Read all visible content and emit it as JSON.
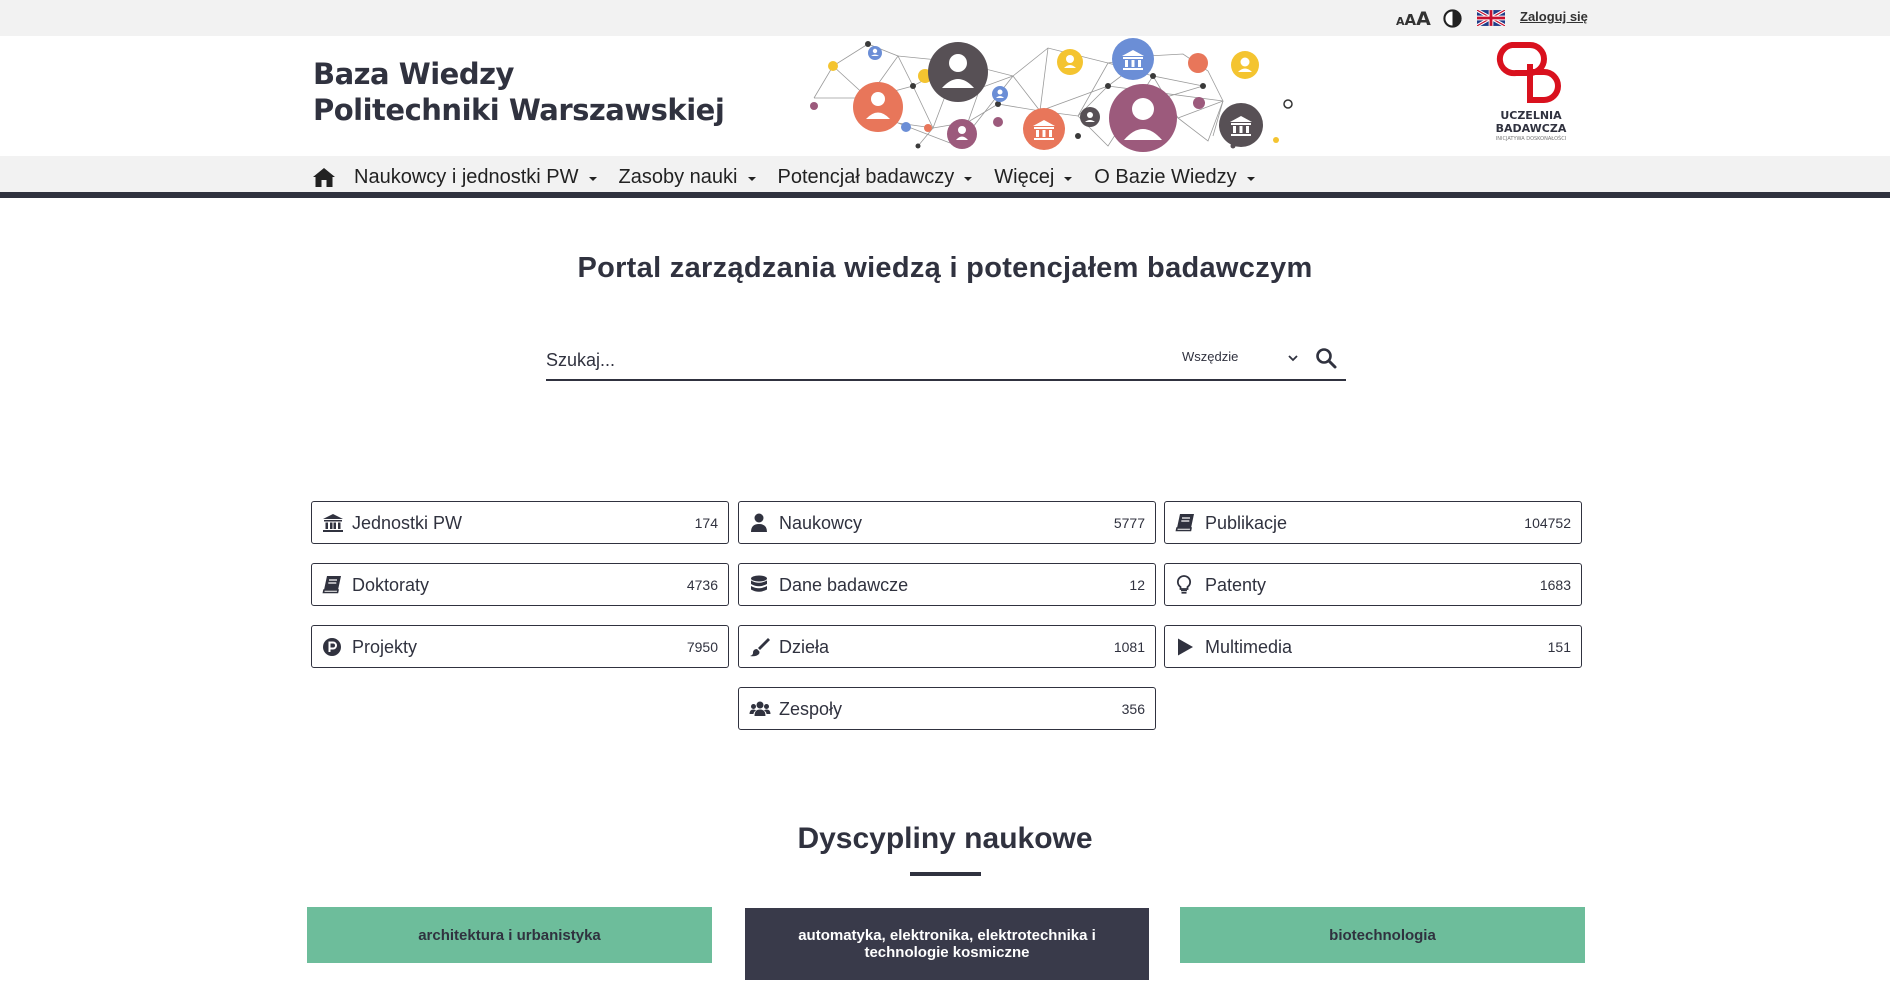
{
  "topbar": {
    "font_size_small": "A",
    "font_size_medium": "A",
    "font_size_large": "A",
    "login_label": "Zaloguj się"
  },
  "header": {
    "logo_line1": "Baza Wiedzy",
    "logo_line2": "Politechniki Warszawskiej",
    "ub_logo_line1": "UCZELNIA",
    "ub_logo_line2": "BADAWCZA",
    "ub_logo_line3": "INICJATYWA DOSKONAŁOŚCI"
  },
  "nav": {
    "items": [
      {
        "label": "Naukowcy i jednostki PW"
      },
      {
        "label": "Zasoby nauki"
      },
      {
        "label": "Potencjał badawczy"
      },
      {
        "label": "Więcej"
      },
      {
        "label": "O Bazie Wiedzy"
      }
    ]
  },
  "hero": {
    "title": "Portal zarządzania wiedzą i potencjałem badawczym",
    "search_placeholder": "Szukaj...",
    "search_scope": "Wszędzie"
  },
  "tiles": [
    {
      "label": "Jednostki PW",
      "count": "174",
      "icon": "institution-icon"
    },
    {
      "label": "Naukowcy",
      "count": "5777",
      "icon": "user-icon"
    },
    {
      "label": "Publikacje",
      "count": "104752",
      "icon": "book-icon"
    },
    {
      "label": "Doktoraty",
      "count": "4736",
      "icon": "book-icon"
    },
    {
      "label": "Dane badawcze",
      "count": "12",
      "icon": "database-icon"
    },
    {
      "label": "Patenty",
      "count": "1683",
      "icon": "lightbulb-icon"
    },
    {
      "label": "Projekty",
      "count": "7950",
      "icon": "project-icon"
    },
    {
      "label": "Dzieła",
      "count": "1081",
      "icon": "brush-icon"
    },
    {
      "label": "Multimedia",
      "count": "151",
      "icon": "play-icon"
    },
    {
      "label": "Zespoły",
      "count": "356",
      "icon": "users-icon"
    }
  ],
  "disciplines": {
    "title": "Dyscypliny naukowe",
    "items": [
      {
        "label": "architektura i urbanistyka",
        "bg": "#6dbd9b",
        "fg": "#30323f"
      },
      {
        "label": "automatyka, elektronika, elektrotechnika i technologie kosmiczne",
        "bg": "#393a4a",
        "fg": "#ffffff"
      },
      {
        "label": "biotechnologia",
        "bg": "#6dbd9b",
        "fg": "#30323f"
      }
    ]
  },
  "colors": {
    "primary": "#30323f",
    "accent_green": "#6dbd9b",
    "brand_red": "#d9111e",
    "topbar_bg": "#f2f2f2"
  }
}
